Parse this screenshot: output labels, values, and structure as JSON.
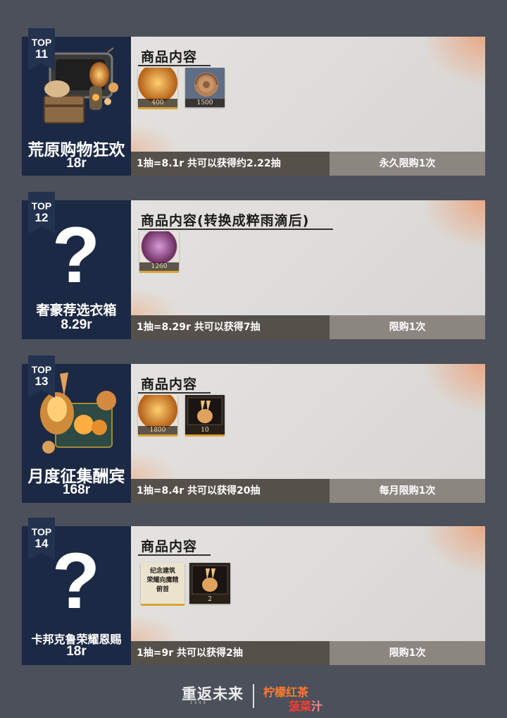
{
  "cards": [
    {
      "rank_label": "TOP",
      "rank_number": "11",
      "name": "荒原购物狂欢",
      "price": "18r",
      "section_title": "商品内容",
      "items": [
        {
          "icon": "amber-gem-icon",
          "qty": "400"
        },
        {
          "icon": "ammonite-fossil-icon",
          "qty": "1500"
        }
      ],
      "detail": "1抽=8.1r 共可以获得约2.22抽",
      "limit": "永久限购1次"
    },
    {
      "rank_label": "TOP",
      "rank_number": "12",
      "name": "奢豪荐选衣箱",
      "price": "8.29r",
      "section_title": "商品内容(转换成粹雨滴后)",
      "items": [
        {
          "icon": "purple-gem-icon",
          "qty": "1260"
        }
      ],
      "detail": "1抽=8.29r 共可以获得7抽",
      "limit": "限购1次"
    },
    {
      "rank_label": "TOP",
      "rank_number": "13",
      "name": "月度征集酬宾",
      "price": "168r",
      "section_title": "商品内容",
      "items": [
        {
          "icon": "amber-gem-icon",
          "qty": "1800"
        },
        {
          "icon": "golden-rabbit-box-icon",
          "qty": "10"
        }
      ],
      "detail": "1抽=8.4r 共可以获得20抽",
      "limit": "每月限购1次"
    },
    {
      "rank_label": "TOP",
      "rank_number": "14",
      "name": "卡邦克鲁荣耀恩赐",
      "price": "18r",
      "section_title": "商品内容",
      "items": [
        {
          "icon": "text-card-icon",
          "text": "纪念建筑\n荣耀向魔精\n俯首"
        },
        {
          "icon": "golden-rabbit-box-icon",
          "qty": "2"
        }
      ],
      "detail": "1抽=9r 共可以获得2抽",
      "limit": "限购1次"
    }
  ],
  "footer": {
    "logo": "重返未来",
    "logo_sub": "1999",
    "author_line1": "柠檬红茶",
    "author_line2a": "菠菜",
    "author_line2b": "汁"
  },
  "colors": {
    "background": "#4b505a",
    "left_panel": "#1c2944",
    "bar_left": "#55504a",
    "bar_right": "#8c8680",
    "author1": "#ff7a2e",
    "author2": "#ff3b2e"
  }
}
